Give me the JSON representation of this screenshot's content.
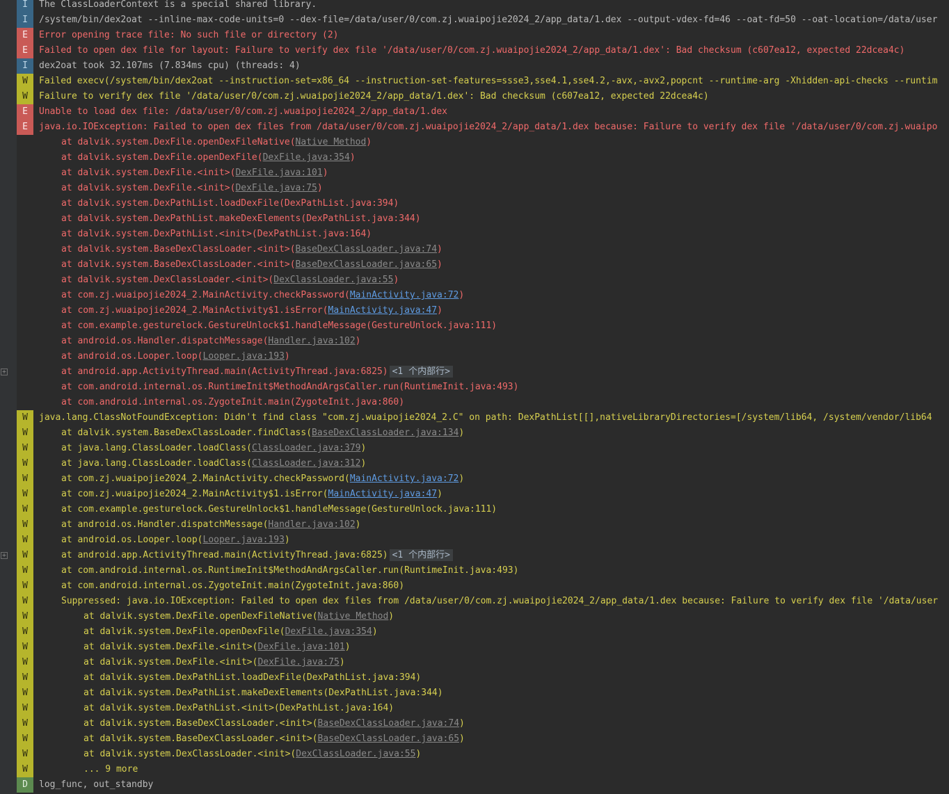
{
  "console": {
    "lines": [
      {
        "level": "I",
        "indent": 0,
        "text": "The ClassLoaderContext is a special shared library."
      },
      {
        "level": "I",
        "indent": 0,
        "text": "/system/bin/dex2oat --inline-max-code-units=0 --dex-file=/data/user/0/com.zj.wuaipojie2024_2/app_data/1.dex --output-vdex-fd=46 --oat-fd=50 --oat-location=/data/user"
      },
      {
        "level": "E",
        "indent": 0,
        "text": "Error opening trace file: No such file or directory (2)"
      },
      {
        "level": "E",
        "indent": 0,
        "text": "Failed to open dex file for layout: Failure to verify dex file '/data/user/0/com.zj.wuaipojie2024_2/app_data/1.dex': Bad checksum (c607ea12, expected 22dcea4c)"
      },
      {
        "level": "I",
        "indent": 0,
        "text": "dex2oat took 32.107ms (7.834ms cpu) (threads: 4)"
      },
      {
        "level": "W",
        "indent": 0,
        "text": "Failed execv(/system/bin/dex2oat --instruction-set=x86_64 --instruction-set-features=ssse3,sse4.1,sse4.2,-avx,-avx2,popcnt --runtime-arg -Xhidden-api-checks --runtim"
      },
      {
        "level": "W",
        "indent": 0,
        "text": "Failure to verify dex file '/data/user/0/com.zj.wuaipojie2024_2/app_data/1.dex': Bad checksum (c607ea12, expected 22dcea4c)"
      },
      {
        "level": "E",
        "indent": 0,
        "text": "Unable to load dex file: /data/user/0/com.zj.wuaipojie2024_2/app_data/1.dex"
      },
      {
        "level": "E",
        "indent": 0,
        "text": "java.io.IOException: Failed to open dex files from /data/user/0/com.zj.wuaipojie2024_2/app_data/1.dex because: Failure to verify dex file '/data/user/0/com.zj.wuaipo"
      },
      {
        "level": "E",
        "indent": 1,
        "hideBadge": true,
        "pre": "at dalvik.system.DexFile.openDexFileNative(",
        "link": "Native Method",
        "linkStyle": "grey",
        "post": ")"
      },
      {
        "level": "E",
        "indent": 1,
        "hideBadge": true,
        "pre": "at dalvik.system.DexFile.openDexFile(",
        "link": "DexFile.java:354",
        "linkStyle": "grey",
        "post": ")"
      },
      {
        "level": "E",
        "indent": 1,
        "hideBadge": true,
        "pre": "at dalvik.system.DexFile.<init>(",
        "link": "DexFile.java:101",
        "linkStyle": "grey",
        "post": ")"
      },
      {
        "level": "E",
        "indent": 1,
        "hideBadge": true,
        "pre": "at dalvik.system.DexFile.<init>(",
        "link": "DexFile.java:75",
        "linkStyle": "grey",
        "post": ")"
      },
      {
        "level": "E",
        "indent": 1,
        "hideBadge": true,
        "text": "at dalvik.system.DexPathList.loadDexFile(DexPathList.java:394)"
      },
      {
        "level": "E",
        "indent": 1,
        "hideBadge": true,
        "text": "at dalvik.system.DexPathList.makeDexElements(DexPathList.java:344)"
      },
      {
        "level": "E",
        "indent": 1,
        "hideBadge": true,
        "text": "at dalvik.system.DexPathList.<init>(DexPathList.java:164)"
      },
      {
        "level": "E",
        "indent": 1,
        "hideBadge": true,
        "pre": "at dalvik.system.BaseDexClassLoader.<init>(",
        "link": "BaseDexClassLoader.java:74",
        "linkStyle": "grey",
        "post": ")"
      },
      {
        "level": "E",
        "indent": 1,
        "hideBadge": true,
        "pre": "at dalvik.system.BaseDexClassLoader.<init>(",
        "link": "BaseDexClassLoader.java:65",
        "linkStyle": "grey",
        "post": ")"
      },
      {
        "level": "E",
        "indent": 1,
        "hideBadge": true,
        "pre": "at dalvik.system.DexClassLoader.<init>(",
        "link": "DexClassLoader.java:55",
        "linkStyle": "grey",
        "post": ")"
      },
      {
        "level": "E",
        "indent": 1,
        "hideBadge": true,
        "pre": "at com.zj.wuaipojie2024_2.MainActivity.checkPassword(",
        "link": "MainActivity.java:72",
        "linkStyle": "blue",
        "post": ")"
      },
      {
        "level": "E",
        "indent": 1,
        "hideBadge": true,
        "pre": "at com.zj.wuaipojie2024_2.MainActivity$1.isError(",
        "link": "MainActivity.java:47",
        "linkStyle": "blue",
        "post": ")"
      },
      {
        "level": "E",
        "indent": 1,
        "hideBadge": true,
        "text": "at com.example.gesturelock.GestureUnlock$1.handleMessage(GestureUnlock.java:111)"
      },
      {
        "level": "E",
        "indent": 1,
        "hideBadge": true,
        "pre": "at android.os.Handler.dispatchMessage(",
        "link": "Handler.java:102",
        "linkStyle": "grey",
        "post": ")"
      },
      {
        "level": "E",
        "indent": 1,
        "hideBadge": true,
        "pre": "at android.os.Looper.loop(",
        "link": "Looper.java:193",
        "linkStyle": "grey",
        "post": ")"
      },
      {
        "level": "E",
        "indent": 1,
        "hideBadge": true,
        "fold": true,
        "text": "at android.app.ActivityThread.main(ActivityThread.java:6825)",
        "collapsed": "<1 个内部行>"
      },
      {
        "level": "E",
        "indent": 1,
        "hideBadge": true,
        "text": "at com.android.internal.os.RuntimeInit$MethodAndArgsCaller.run(RuntimeInit.java:493)"
      },
      {
        "level": "E",
        "indent": 1,
        "hideBadge": true,
        "text": "at com.android.internal.os.ZygoteInit.main(ZygoteInit.java:860)"
      },
      {
        "level": "W",
        "indent": 0,
        "text": "java.lang.ClassNotFoundException: Didn't find class \"com.zj.wuaipojie2024_2.C\" on path: DexPathList[[],nativeLibraryDirectories=[/system/lib64, /system/vendor/lib64"
      },
      {
        "level": "W",
        "indent": 1,
        "pre": "at dalvik.system.BaseDexClassLoader.findClass(",
        "link": "BaseDexClassLoader.java:134",
        "linkStyle": "grey",
        "post": ")"
      },
      {
        "level": "W",
        "indent": 1,
        "pre": "at java.lang.ClassLoader.loadClass(",
        "link": "ClassLoader.java:379",
        "linkStyle": "grey",
        "post": ")"
      },
      {
        "level": "W",
        "indent": 1,
        "pre": "at java.lang.ClassLoader.loadClass(",
        "link": "ClassLoader.java:312",
        "linkStyle": "grey",
        "post": ")"
      },
      {
        "level": "W",
        "indent": 1,
        "pre": "at com.zj.wuaipojie2024_2.MainActivity.checkPassword(",
        "link": "MainActivity.java:72",
        "linkStyle": "blue",
        "post": ")"
      },
      {
        "level": "W",
        "indent": 1,
        "pre": "at com.zj.wuaipojie2024_2.MainActivity$1.isError(",
        "link": "MainActivity.java:47",
        "linkStyle": "blue",
        "post": ")"
      },
      {
        "level": "W",
        "indent": 1,
        "text": "at com.example.gesturelock.GestureUnlock$1.handleMessage(GestureUnlock.java:111)"
      },
      {
        "level": "W",
        "indent": 1,
        "pre": "at android.os.Handler.dispatchMessage(",
        "link": "Handler.java:102",
        "linkStyle": "grey",
        "post": ")"
      },
      {
        "level": "W",
        "indent": 1,
        "pre": "at android.os.Looper.loop(",
        "link": "Looper.java:193",
        "linkStyle": "grey",
        "post": ")"
      },
      {
        "level": "W",
        "indent": 1,
        "fold": true,
        "text": "at android.app.ActivityThread.main(ActivityThread.java:6825)",
        "collapsed": "<1 个内部行>"
      },
      {
        "level": "W",
        "indent": 1,
        "text": "at com.android.internal.os.RuntimeInit$MethodAndArgsCaller.run(RuntimeInit.java:493)"
      },
      {
        "level": "W",
        "indent": 1,
        "text": "at com.android.internal.os.ZygoteInit.main(ZygoteInit.java:860)"
      },
      {
        "level": "W",
        "indent": 1,
        "text": "Suppressed: java.io.IOException: Failed to open dex files from /data/user/0/com.zj.wuaipojie2024_2/app_data/1.dex because: Failure to verify dex file '/data/user"
      },
      {
        "level": "W",
        "indent": 2,
        "pre": "at dalvik.system.DexFile.openDexFileNative(",
        "link": "Native Method",
        "linkStyle": "grey",
        "post": ")"
      },
      {
        "level": "W",
        "indent": 2,
        "pre": "at dalvik.system.DexFile.openDexFile(",
        "link": "DexFile.java:354",
        "linkStyle": "grey",
        "post": ")"
      },
      {
        "level": "W",
        "indent": 2,
        "pre": "at dalvik.system.DexFile.<init>(",
        "link": "DexFile.java:101",
        "linkStyle": "grey",
        "post": ")"
      },
      {
        "level": "W",
        "indent": 2,
        "pre": "at dalvik.system.DexFile.<init>(",
        "link": "DexFile.java:75",
        "linkStyle": "grey",
        "post": ")"
      },
      {
        "level": "W",
        "indent": 2,
        "text": "at dalvik.system.DexPathList.loadDexFile(DexPathList.java:394)"
      },
      {
        "level": "W",
        "indent": 2,
        "text": "at dalvik.system.DexPathList.makeDexElements(DexPathList.java:344)"
      },
      {
        "level": "W",
        "indent": 2,
        "text": "at dalvik.system.DexPathList.<init>(DexPathList.java:164)"
      },
      {
        "level": "W",
        "indent": 2,
        "pre": "at dalvik.system.BaseDexClassLoader.<init>(",
        "link": "BaseDexClassLoader.java:74",
        "linkStyle": "grey",
        "post": ")"
      },
      {
        "level": "W",
        "indent": 2,
        "pre": "at dalvik.system.BaseDexClassLoader.<init>(",
        "link": "BaseDexClassLoader.java:65",
        "linkStyle": "grey",
        "post": ")"
      },
      {
        "level": "W",
        "indent": 2,
        "pre": "at dalvik.system.DexClassLoader.<init>(",
        "link": "DexClassLoader.java:55",
        "linkStyle": "grey",
        "post": ")"
      },
      {
        "level": "W",
        "indent": 2,
        "text": "... 9 more"
      },
      {
        "level": "D",
        "indent": 0,
        "text": "log_func, out_standby"
      }
    ]
  },
  "colors": {
    "background": "#2b2b2b",
    "info": "#386585",
    "error": "#c95a56",
    "warn": "#b6b52c",
    "debug": "#5c8a4f",
    "link_blue": "#5f9ce3",
    "link_grey": "#8a8a8a"
  },
  "icons": {
    "fold": "fold-expand-icon"
  }
}
